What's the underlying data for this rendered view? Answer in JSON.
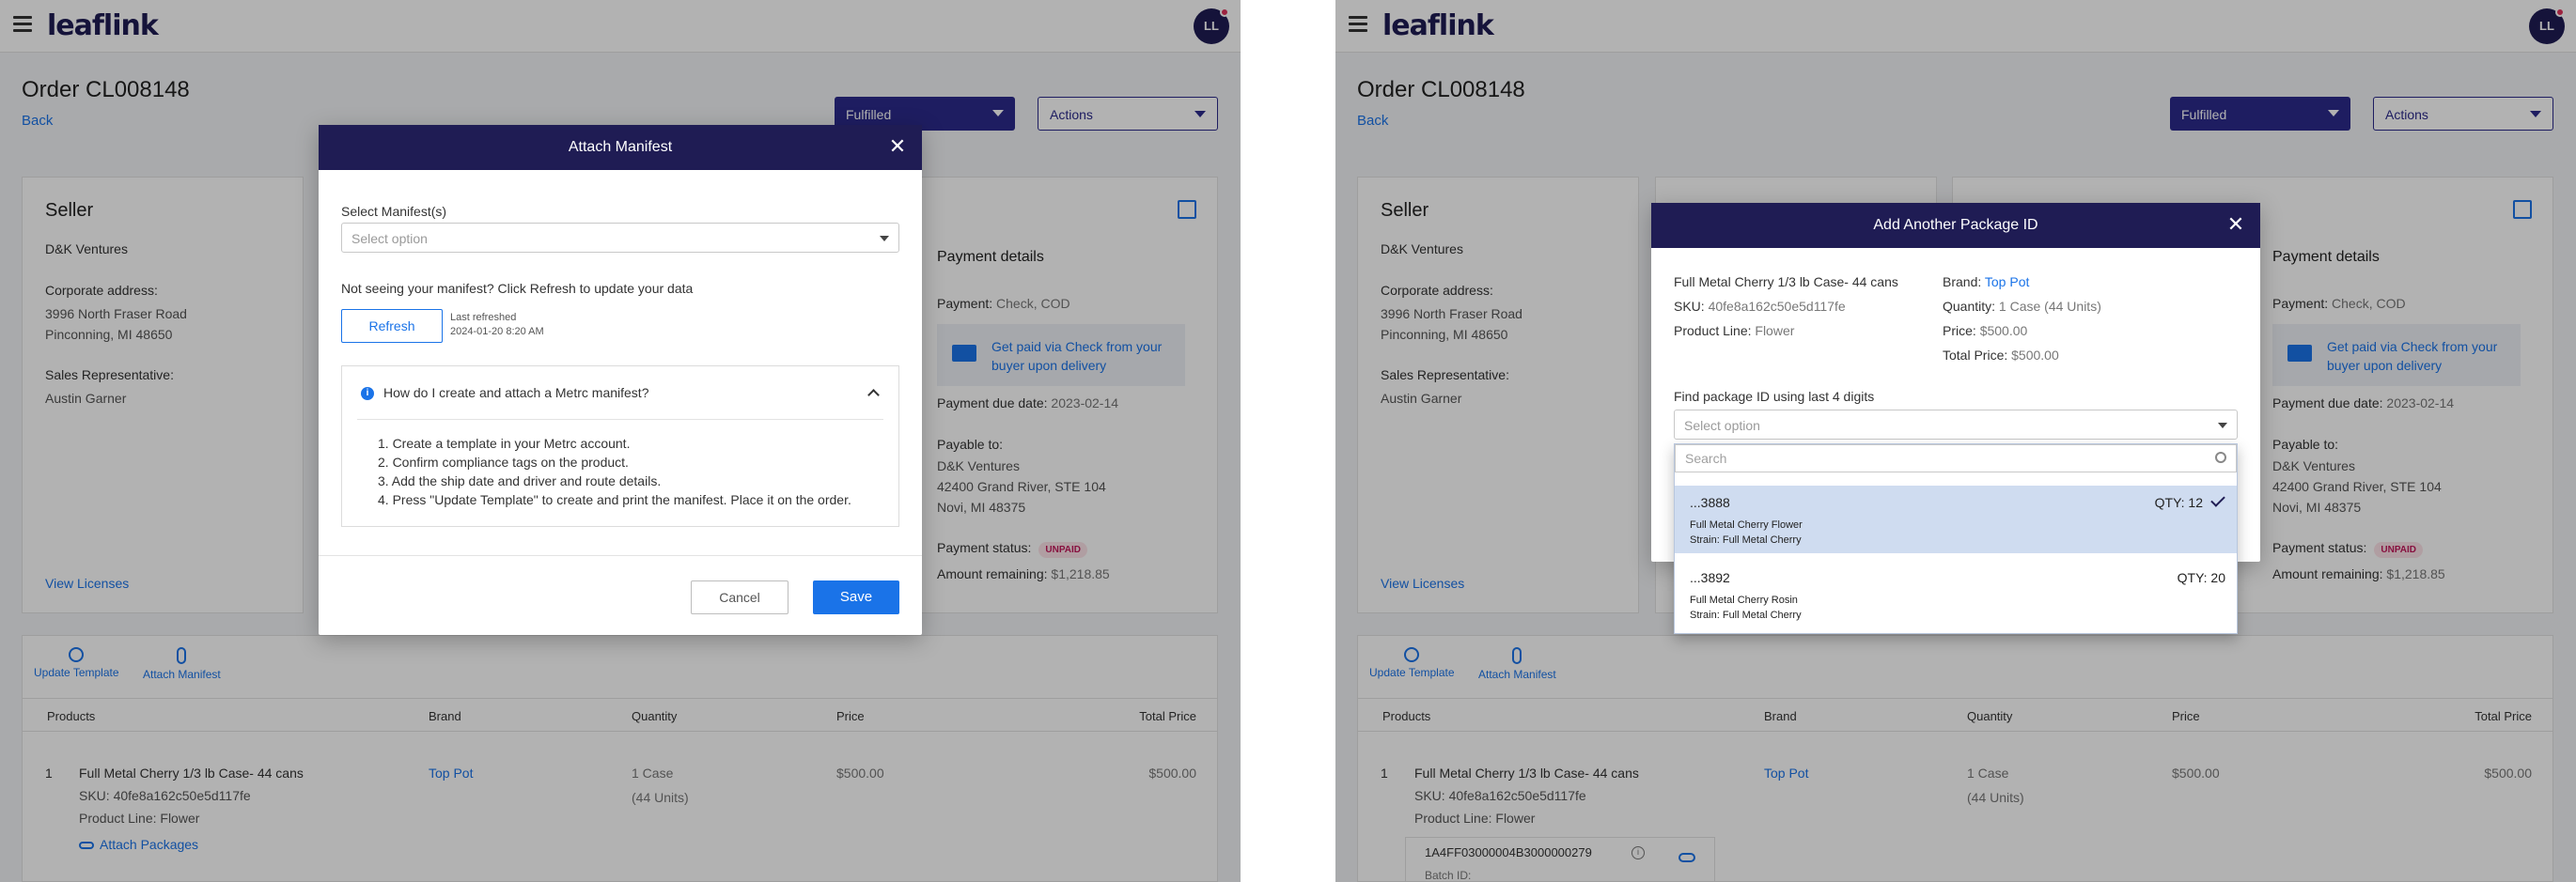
{
  "app": {
    "logo": "leaflink",
    "avatar_initials": "LL"
  },
  "order": {
    "title": "Order CL008148",
    "back": "Back",
    "status": "Fulfilled",
    "actions": "Actions"
  },
  "seller": {
    "heading": "Seller",
    "name": "D&K Ventures",
    "corporate_label": "Corporate address:",
    "address_line1": "3996 North Fraser Road",
    "address_line2": "Pinconning, MI 48650",
    "rep_label": "Sales Representative:",
    "rep_name": "Austin Garner",
    "view_licenses": "View Licenses"
  },
  "payment": {
    "heading": "Payment details",
    "payment_label": "Payment:",
    "payment_value": "Check, COD",
    "notice": "Get paid via Check from your buyer upon delivery",
    "due_label": "Payment due date:",
    "due_value": "2023-02-14",
    "payable_label": "Payable to:",
    "payable_name": "D&K Ventures",
    "payable_line1": "42400 Grand River, STE 104",
    "payable_line2": "Novi, MI 48375",
    "status_label": "Payment status:",
    "status_badge": "UNPAID",
    "remaining_label": "Amount remaining:",
    "remaining_value": "$1,218.85"
  },
  "toolbar": {
    "update_template": "Update Template",
    "attach_manifest": "Attach Manifest"
  },
  "table": {
    "headers": {
      "products": "Products",
      "brand": "Brand",
      "quantity": "Quantity",
      "price": "Price",
      "total": "Total Price"
    },
    "row": {
      "index": "1",
      "name": "Full Metal Cherry 1/3 lb Case- 44 cans",
      "sku": "SKU: 40fe8a162c50e5d117fe",
      "product_line": "Product Line: Flower",
      "brand": "Top Pot",
      "qty_line1": "1 Case",
      "qty_line2": "(44 Units)",
      "price": "$500.00",
      "total": "$500.00",
      "attach_packages": "Attach Packages",
      "package_id": "1A4FF03000004B3000000279",
      "batch_label": "Batch ID:"
    }
  },
  "manifest_modal": {
    "title": "Attach Manifest",
    "select_label": "Select Manifest(s)",
    "select_placeholder": "Select option",
    "hint": "Not seeing your manifest? Click Refresh to update your data",
    "refresh": "Refresh",
    "last_refreshed_label": "Last refreshed",
    "last_refreshed_value": "2024-01-20 8:20 AM",
    "faq_title": "How do I create and attach a Metrc manifest?",
    "steps": [
      "1.  Create a template in your Metrc account.",
      "2.  Confirm compliance tags on the product.",
      "3.  Add the ship date and driver and route details.",
      "4.  Press \"Update Template\" to create and print the manifest. Place it on the order."
    ],
    "cancel": "Cancel",
    "save": "Save"
  },
  "package_modal": {
    "title": "Add Another Package ID",
    "product_name": "Full Metal Cherry 1/3 lb Case- 44 cans",
    "sku_label": "SKU:",
    "sku_value": "40fe8a162c50e5d117fe",
    "line_label": "Product Line:",
    "line_value": "Flower",
    "brand_label": "Brand:",
    "brand_value": "Top Pot",
    "qty_label": "Quantity:",
    "qty_value": "1 Case (44 Units)",
    "price_label": "Price:",
    "price_value": "$500.00",
    "total_label": "Total Price:",
    "total_value": "$500.00",
    "find_label": "Find package ID using last 4 digits",
    "select_placeholder": "Select option",
    "search_placeholder": "Search",
    "options": [
      {
        "id": "...3888",
        "qty": "QTY: 12",
        "product": "Full Metal Cherry Flower",
        "strain": "Strain: Full Metal Cherry",
        "selected": true
      },
      {
        "id": "...3892",
        "qty": "QTY: 20",
        "product": "Full Metal Cherry Rosin",
        "strain": "Strain: Full Metal Cherry",
        "selected": false
      }
    ]
  },
  "colors": {
    "brand_navy": "#1f1c54",
    "primary_blue": "#1a73e8",
    "status_purple": "#2b2a8c",
    "selected_row": "#cfdcf0"
  }
}
